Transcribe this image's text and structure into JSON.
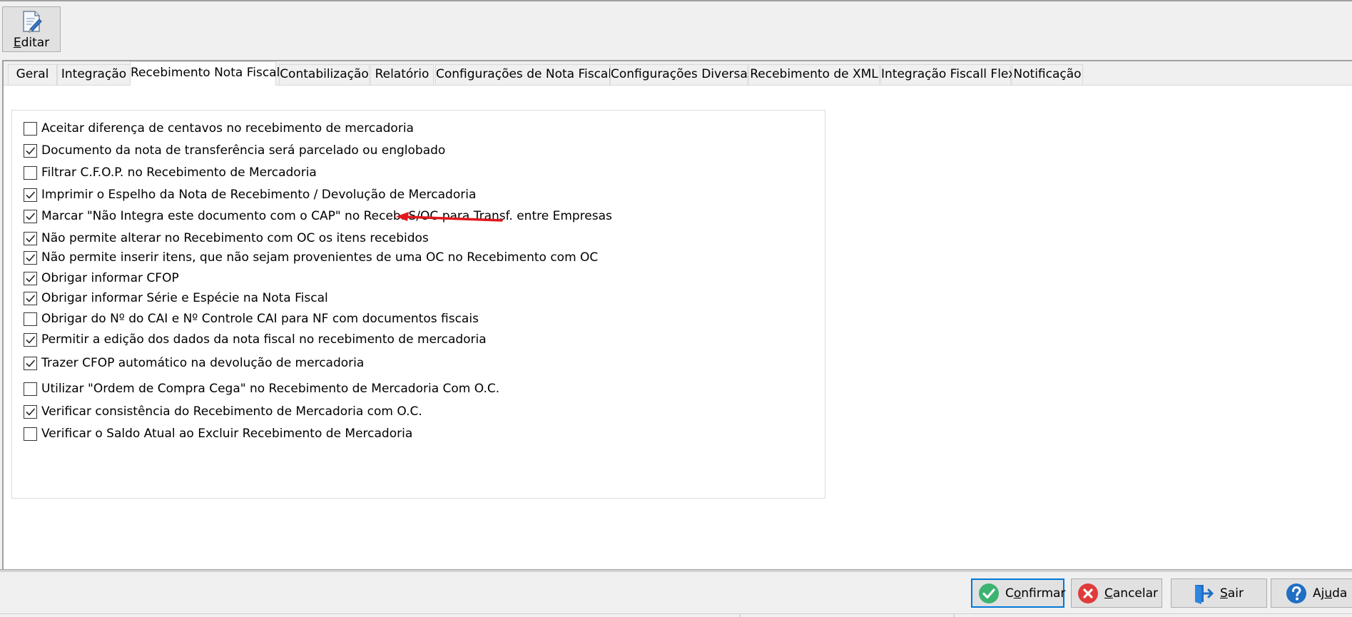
{
  "toolbar": {
    "edit_label_prefix": "E",
    "edit_label_rest": "ditar"
  },
  "tabs": [
    {
      "label": "Geral",
      "active": false
    },
    {
      "label": "Integração",
      "active": false
    },
    {
      "label": "Recebimento Nota Fiscal",
      "active": true
    },
    {
      "label": "Contabilização",
      "active": false
    },
    {
      "label": "Relatório",
      "active": false
    },
    {
      "label": "Configurações de Nota Fiscal",
      "active": false
    },
    {
      "label": "Configurações Diversas",
      "active": false
    },
    {
      "label": "Recebimento de XML",
      "active": false
    },
    {
      "label": "Integração Fiscall Flex",
      "active": false
    },
    {
      "label": "Notificação",
      "active": false
    }
  ],
  "options": [
    {
      "label": "Aceitar diferença de centavos no recebimento de mercadoria",
      "checked": false
    },
    {
      "label": "Documento da nota de transferência será parcelado ou englobado",
      "checked": true
    },
    {
      "label": "Filtrar C.F.O.P. no Recebimento de Mercadoria",
      "checked": false
    },
    {
      "label": "Imprimir o Espelho da Nota de Recebimento / Devolução de Mercadoria",
      "checked": true
    },
    {
      "label": "Marcar \"Não Integra este documento com o CAP\" no Receb. S/OC para Transf. entre Empresas",
      "checked": true
    },
    {
      "label": "Não permite alterar no Recebimento com OC os itens recebidos",
      "checked": true
    },
    {
      "label": "Não permite inserir itens, que não sejam provenientes de uma OC no Recebimento com OC",
      "checked": true
    },
    {
      "label": "Obrigar informar CFOP",
      "checked": true
    },
    {
      "label": "Obrigar informar Série e Espécie na Nota Fiscal",
      "checked": true
    },
    {
      "label": "Obrigar do Nº do CAI e Nº Controle CAI para NF com documentos fiscais",
      "checked": false
    },
    {
      "label": "Permitir a edição dos dados da nota fiscal no recebimento de mercadoria",
      "checked": true
    },
    {
      "label": "Trazer CFOP automático na devolução de mercadoria",
      "checked": true
    },
    {
      "label": "Utilizar \"Ordem de Compra Cega\" no Recebimento de Mercadoria Com O.C.",
      "checked": false
    },
    {
      "label": "Verificar consistência do Recebimento de Mercadoria com O.C.",
      "checked": true
    },
    {
      "label": "Verificar o Saldo Atual ao Excluir Recebimento de Mercadoria",
      "checked": false
    }
  ],
  "buttons": {
    "confirm": {
      "pre": "C",
      "u": "o",
      "post": "nfirmar",
      "color": "#3cb371"
    },
    "cancel": {
      "pre": "",
      "u": "C",
      "post": "ancelar",
      "color": "#e03b3b"
    },
    "exit": {
      "pre": "",
      "u": "S",
      "post": "air",
      "color": "#1f6fc4"
    },
    "help": {
      "pre": "Aj",
      "u": "u",
      "post": "da",
      "color": "#1f6fc4"
    }
  },
  "icons": {
    "edit": "edit-document-icon",
    "confirm": "check-circle-icon",
    "cancel": "x-circle-icon",
    "exit": "exit-door-icon",
    "help": "question-circle-icon"
  }
}
